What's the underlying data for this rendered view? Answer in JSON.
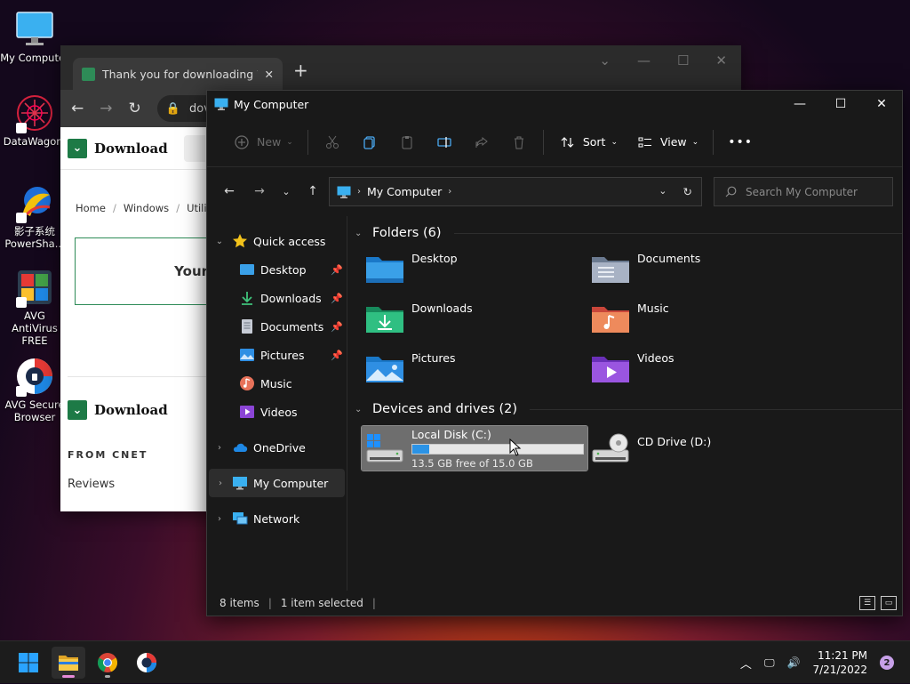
{
  "desktop": {
    "icons": [
      {
        "label": "My Computer"
      },
      {
        "label": "DataWagon."
      },
      {
        "label": "影子系统 PowerSha..."
      },
      {
        "label": "AVG AntiVirus FREE"
      },
      {
        "label": "AVG Secure Browser"
      }
    ]
  },
  "browser": {
    "tab_title": "Thank you for downloading Win",
    "url_text": "dov",
    "logo_text": "Download",
    "breadcrumb": [
      "Home",
      "/",
      "Windows",
      "/",
      "Utiliti"
    ],
    "card_text": "Your d",
    "logo_text_2": "Download",
    "from_label": "FROM CNET",
    "reviews_label": "Reviews"
  },
  "explorer": {
    "title": "My Computer",
    "commands": {
      "new": "New",
      "sort": "Sort",
      "view": "View",
      "more": "•••"
    },
    "address": {
      "location": "My Computer"
    },
    "search": {
      "placeholder": "Search My Computer"
    },
    "sidebar": {
      "quick_access": "Quick access",
      "items": [
        {
          "label": "Desktop",
          "pinned": true
        },
        {
          "label": "Downloads",
          "pinned": true
        },
        {
          "label": "Documents",
          "pinned": true
        },
        {
          "label": "Pictures",
          "pinned": true
        },
        {
          "label": "Music",
          "pinned": false
        },
        {
          "label": "Videos",
          "pinned": false
        }
      ],
      "onedrive": "OneDrive",
      "my_computer": "My Computer",
      "network": "Network"
    },
    "folders_group": "Folders (6)",
    "folders": [
      "Desktop",
      "Documents",
      "Downloads",
      "Music",
      "Pictures",
      "Videos"
    ],
    "devices_group": "Devices and drives (2)",
    "drives": [
      {
        "name": "Local Disk (C:)",
        "free_text": "13.5 GB free of 15.0 GB",
        "used_fraction": 0.1
      },
      {
        "name": "CD Drive (D:)"
      }
    ],
    "status": {
      "items": "8 items",
      "selected": "1 item selected"
    }
  },
  "taskbar": {
    "time": "11:21 PM",
    "date": "7/21/2022",
    "notifications": "2"
  },
  "colors": {
    "accent": "#2b93e6",
    "folder": "#3aa0e8",
    "cnet_green": "#1d7a46"
  }
}
